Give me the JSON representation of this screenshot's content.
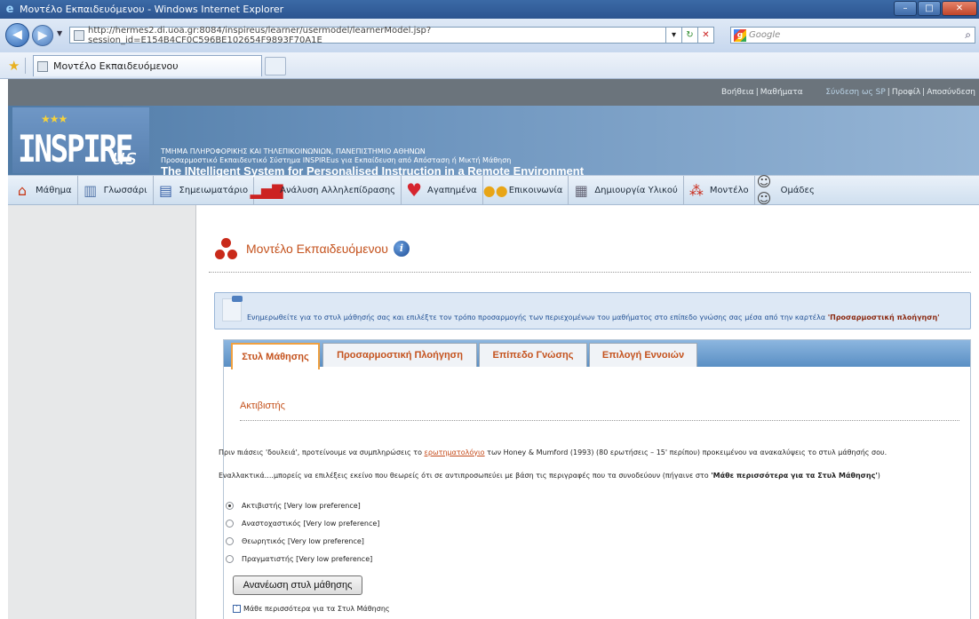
{
  "browser": {
    "window_title": "Μοντέλο Εκπαιδευόμενου - Windows Internet Explorer",
    "url": "http://hermes2.di.uoa.gr:8084/inspireus/learner/usermodel/learnerModel.jsp?session_id=E154B4CF0C596BE102654F9893F70A1E",
    "search_placeholder": "Google",
    "tab_title": "Μοντέλο Εκπαιδευόμενου",
    "win_min": "–",
    "win_max": "□",
    "win_close": "✕"
  },
  "site": {
    "toplinks": {
      "help": "Βοήθεια",
      "courses": "Μαθήματα",
      "login_as": "Σύνδεση ως SP",
      "profile": "Προφίλ",
      "logout": "Αποσύνδεση"
    },
    "banner": {
      "logo_main": "INSPIRE",
      "logo_suffix": "us",
      "line1": "ΤΜΗΜΑ ΠΛΗΡΟΦΟΡΙΚΗΣ ΚΑΙ ΤΗΛΕΠΙΚΟΙΝΩΝΙΩΝ, ΠΑΝΕΠΙΣΤΗΜΙΟ ΑΘΗΝΩΝ",
      "line2": "Προσαρμοστικό Εκπαιδευτικό Σύστημα INSPIREus για Εκπαίδευση από Απόσταση ή Μικτή Μάθηση",
      "line3": "The INtelligent System for Personalised Instruction in a Remote Environment"
    },
    "menu": [
      {
        "label": "Μάθημα",
        "icon": "home-icon"
      },
      {
        "label": "Γλωσσάρι",
        "icon": "book-icon"
      },
      {
        "label": "Σημειωματάριο",
        "icon": "notes-icon"
      },
      {
        "label": "Ανάλυση Αλληλεπίδρασης",
        "icon": "bar-chart-icon"
      },
      {
        "label": "Αγαπημένα",
        "icon": "heart-icon"
      },
      {
        "label": "Επικοινωνία",
        "icon": "chat-icon"
      },
      {
        "label": "Δημιουργία Υλικού",
        "icon": "create-material-icon"
      },
      {
        "label": "Μοντέλο",
        "icon": "model-icon"
      },
      {
        "label": "Ομάδες",
        "icon": "groups-icon"
      }
    ]
  },
  "main": {
    "title": "Μοντέλο Εκπαιδευόμενου",
    "info_text_prefix": "Ενημερωθείτε για το στυλ μάθησής σας και επιλέξτε τον τρόπο προσαρμογής των περιεχομένων του μαθήματος στο επίπεδο γνώσης σας μέσα από την καρτέλα",
    "info_text_bold": "'Προσαρμοστική πλοήγηση'",
    "tabs": [
      "Στυλ Μάθησης",
      "Προσαρμοστική Πλοήγηση",
      "Επίπεδο Γνώσης",
      "Επιλογή Εννοιών"
    ],
    "section_title": "Ακτιβιστής",
    "para1_before": "Πριν πιάσεις 'δουλειά', προτείνουμε να συμπληρώσεις το",
    "para1_link": "ερωτηματολόγιο",
    "para1_after": "των Honey & Mumford (1993) (80 ερωτήσεις – 15' περίπου) προκειμένου να ανακαλύψεις το στυλ μάθησής σου.",
    "para2_before": "Εναλλακτικά....μπορείς να επιλέξεις εκείνο που θεωρείς ότι σε αντιπροσωπεύει με βάση τις περιγραφές που τα συνοδεύουν (πήγαινε στο",
    "para2_bold": "'Μάθε περισσότερα για τα Στυλ Μάθησης'",
    "para2_after": ")",
    "options": [
      {
        "label": "Ακτιβιστής  [Very low preference]",
        "checked": true
      },
      {
        "label": "Αναστοχαστικός  [Very low preference]",
        "checked": false
      },
      {
        "label": "Θεωρητικός  [Very low preference]",
        "checked": false
      },
      {
        "label": "Πραγματιστής  [Very low preference]",
        "checked": false
      }
    ],
    "refresh_button": "Ανανέωση στυλ μάθησης",
    "learn_more": "Μάθε περισσότερα για τα Στυλ Μάθησης"
  }
}
